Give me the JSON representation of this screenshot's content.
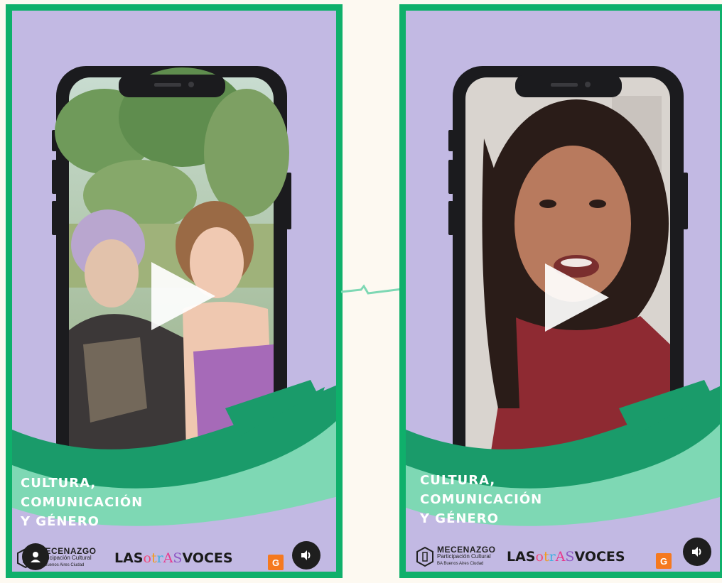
{
  "cards": [
    {
      "id": "left",
      "title_lines": [
        "CULTURA,",
        "COMUNICACIÓN",
        "Y GÉNERO"
      ],
      "sponsor": {
        "name": "MECENAZGO",
        "sub": "Participación Cultural",
        "ba": "BA Buenos Aires Ciudad"
      },
      "brand": {
        "prefix": "LAS",
        "otras": [
          "o",
          "t",
          "r",
          "A",
          "S"
        ],
        "suffix": "VOCES"
      },
      "orange_label": "G",
      "controls": {
        "play": "play-icon",
        "volume": "volume-icon",
        "profile": "user-icon"
      }
    },
    {
      "id": "right",
      "title_lines": [
        "CULTURA,",
        "COMUNICACIÓN",
        "Y GÉNERO"
      ],
      "sponsor": {
        "name": "MECENAZGO",
        "sub": "Participación Cultural",
        "ba": "BA Buenos Aires Ciudad"
      },
      "brand": {
        "prefix": "LAS",
        "otras": [
          "o",
          "t",
          "r",
          "A",
          "S"
        ],
        "suffix": "VOCES"
      },
      "orange_label": "G",
      "controls": {
        "play": "play-icon",
        "volume": "volume-icon"
      }
    }
  ],
  "colors": {
    "frame": "#0fb06b",
    "background": "#c2b9e3",
    "wave_dark": "#1a9b6a",
    "wave_light": "#7ed8b4",
    "page": "#fdf9f1"
  }
}
